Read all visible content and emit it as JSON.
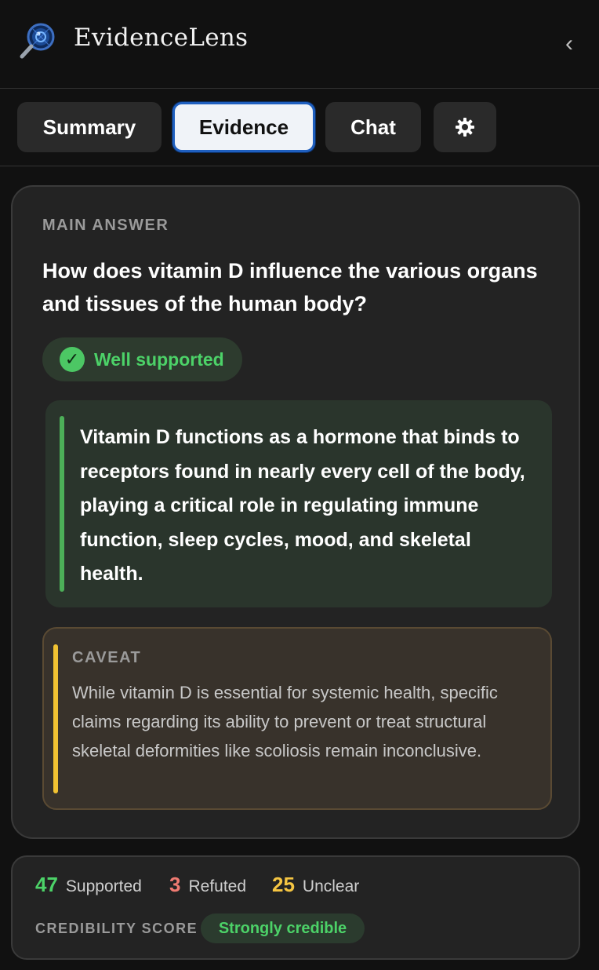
{
  "app": {
    "title": "EvidenceLens",
    "collapse_glyph": "‹"
  },
  "tabs": [
    {
      "label": "Summary",
      "active": false
    },
    {
      "label": "Evidence",
      "active": true
    },
    {
      "label": "Chat",
      "active": false
    },
    {
      "label": "",
      "icon": "gear-icon",
      "active": false
    }
  ],
  "main": {
    "section_label": "MAIN ANSWER",
    "question": "How does vitamin D influence the various organs and tissues of the human body?",
    "badge": {
      "icon": "check-circle-icon",
      "label": "Well supported"
    },
    "answer": "Vitamin D functions as a hormone that binds to receptors found in nearly every cell of the body, playing a critical role in regulating immune function, sleep cycles, mood, and skeletal health.",
    "caveat": {
      "label": "CAVEAT",
      "text": "While vitamin D is essential for systemic health, specific claims regarding its ability to prevent or treat structural skeletal deformities like scoliosis remain inconclusive."
    }
  },
  "stats": {
    "supported": {
      "count": "47",
      "label": "Supported",
      "color": "#4cd268"
    },
    "refuted": {
      "count": "3",
      "label": "Refuted",
      "color": "#f07b72"
    },
    "unclear": {
      "count": "25",
      "label": "Unclear",
      "color": "#f5c542"
    },
    "credibility_label": "CREDIBILITY SCORE",
    "credibility_value": "Strongly credible"
  },
  "colors": {
    "accent": "#1f5fbf",
    "supported": "#4cd268",
    "caveat": "#f1c232",
    "background": "#111111",
    "card": "#232323"
  }
}
